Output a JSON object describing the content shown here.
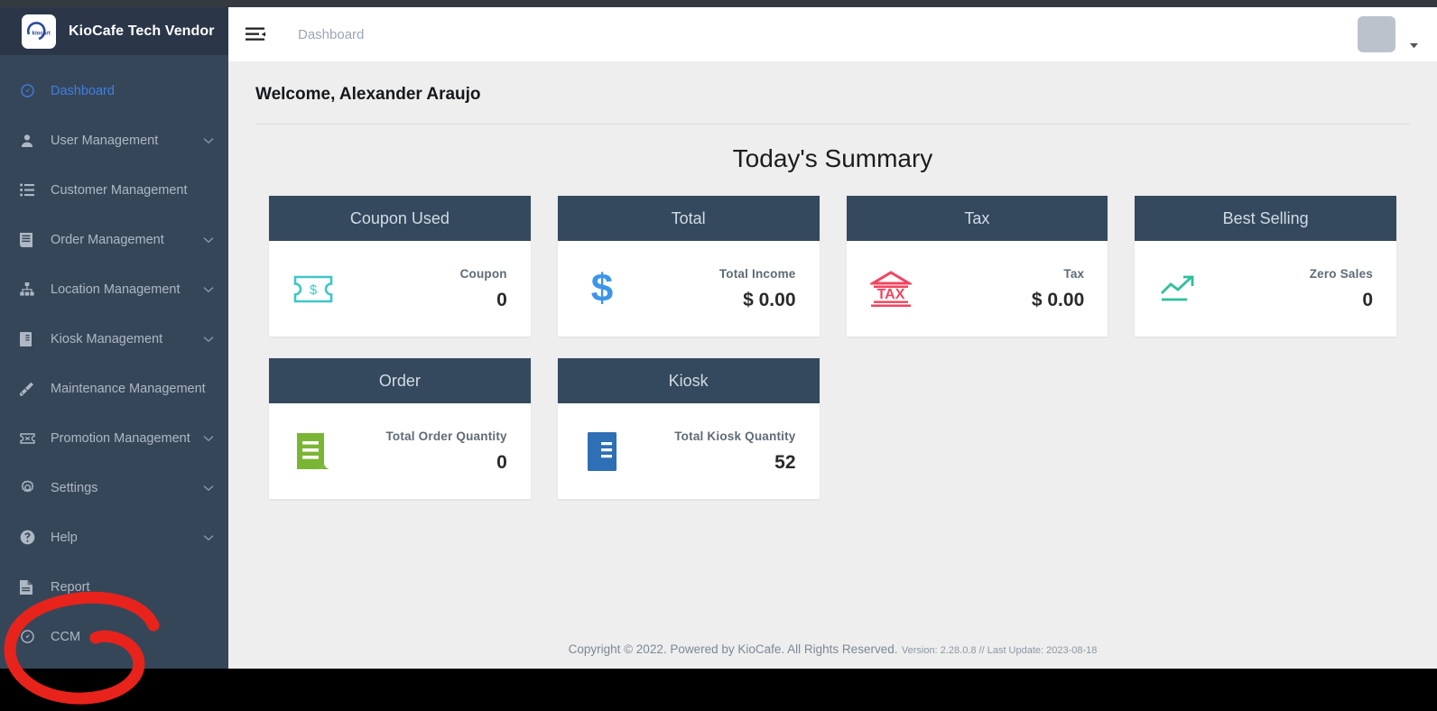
{
  "brand": {
    "title": "KioCafe Tech Vendor",
    "logo_text": "kiocart",
    "logo_icon": "kiocafe-logo-icon"
  },
  "sidebar": {
    "items": [
      {
        "label": "Dashboard",
        "icon": "gauge-icon",
        "active": true,
        "caret": false
      },
      {
        "label": "User Management",
        "icon": "user-icon",
        "active": false,
        "caret": true
      },
      {
        "label": "Customer Management",
        "icon": "list-icon",
        "active": false,
        "caret": false
      },
      {
        "label": "Order Management",
        "icon": "document-lines-icon",
        "active": false,
        "caret": true
      },
      {
        "label": "Location Management",
        "icon": "sitemap-icon",
        "active": false,
        "caret": true
      },
      {
        "label": "Kiosk Management",
        "icon": "kiosk-screen-icon",
        "active": false,
        "caret": true
      },
      {
        "label": "Maintenance Management",
        "icon": "paint-roller-icon",
        "active": false,
        "caret": false
      },
      {
        "label": "Promotion Management",
        "icon": "ticket-icon",
        "active": false,
        "caret": true
      },
      {
        "label": "Settings",
        "icon": "gear-icon",
        "active": false,
        "caret": true
      },
      {
        "label": "Help",
        "icon": "question-circle-icon",
        "active": false,
        "caret": true
      },
      {
        "label": "Report",
        "icon": "file-lines-icon",
        "active": false,
        "caret": false
      },
      {
        "label": "CCM",
        "icon": "gauge-icon",
        "active": false,
        "caret": false
      }
    ]
  },
  "topbar": {
    "menu_icon": "hamburger-collapse-icon",
    "breadcrumb": "Dashboard",
    "avatar": "user-avatar",
    "caret_icon": "caret-down-icon"
  },
  "main": {
    "welcome": "Welcome, Alexander Araujo",
    "summary_title": "Today's Summary"
  },
  "cards": [
    {
      "title": "Coupon Used",
      "stat_label": "Coupon",
      "stat_value": "0",
      "icon": "coupon-ticket-icon",
      "icon_color": "#3ec6c9"
    },
    {
      "title": "Total",
      "stat_label": "Total Income",
      "stat_value": "$ 0.00",
      "icon": "dollar-sign-icon",
      "icon_color": "#3d95e8"
    },
    {
      "title": "Tax",
      "stat_label": "Tax",
      "stat_value": "$ 0.00",
      "icon": "tax-building-icon",
      "icon_color": "#f1455f"
    },
    {
      "title": "Best Selling",
      "stat_label": "Zero Sales",
      "stat_value": "0",
      "icon": "trend-up-icon",
      "icon_color": "#2fbf9a"
    },
    {
      "title": "Order",
      "stat_label": "Total Order Quantity",
      "stat_value": "0",
      "icon": "order-receipt-icon",
      "icon_color": "#7ab534"
    },
    {
      "title": "Kiosk",
      "stat_label": "Total Kiosk Quantity",
      "stat_value": "52",
      "icon": "kiosk-device-icon",
      "icon_color": "#2f6fb5"
    }
  ],
  "footer": {
    "copyright": "Copyright © 2022. Powered by KioCafe. All Rights Reserved.",
    "version": "Version: 2.28.0.8 // Last Update: 2023-08-18"
  },
  "annotation": {
    "type": "hand-drawn-circle",
    "color": "#e8231c",
    "target": "CCM"
  },
  "colors": {
    "sidebar_bg": "#364659",
    "brand_bg": "#2b3648",
    "card_header": "#34495e",
    "active_blue": "#3f7fe0",
    "content_bg": "#eeeeee"
  }
}
